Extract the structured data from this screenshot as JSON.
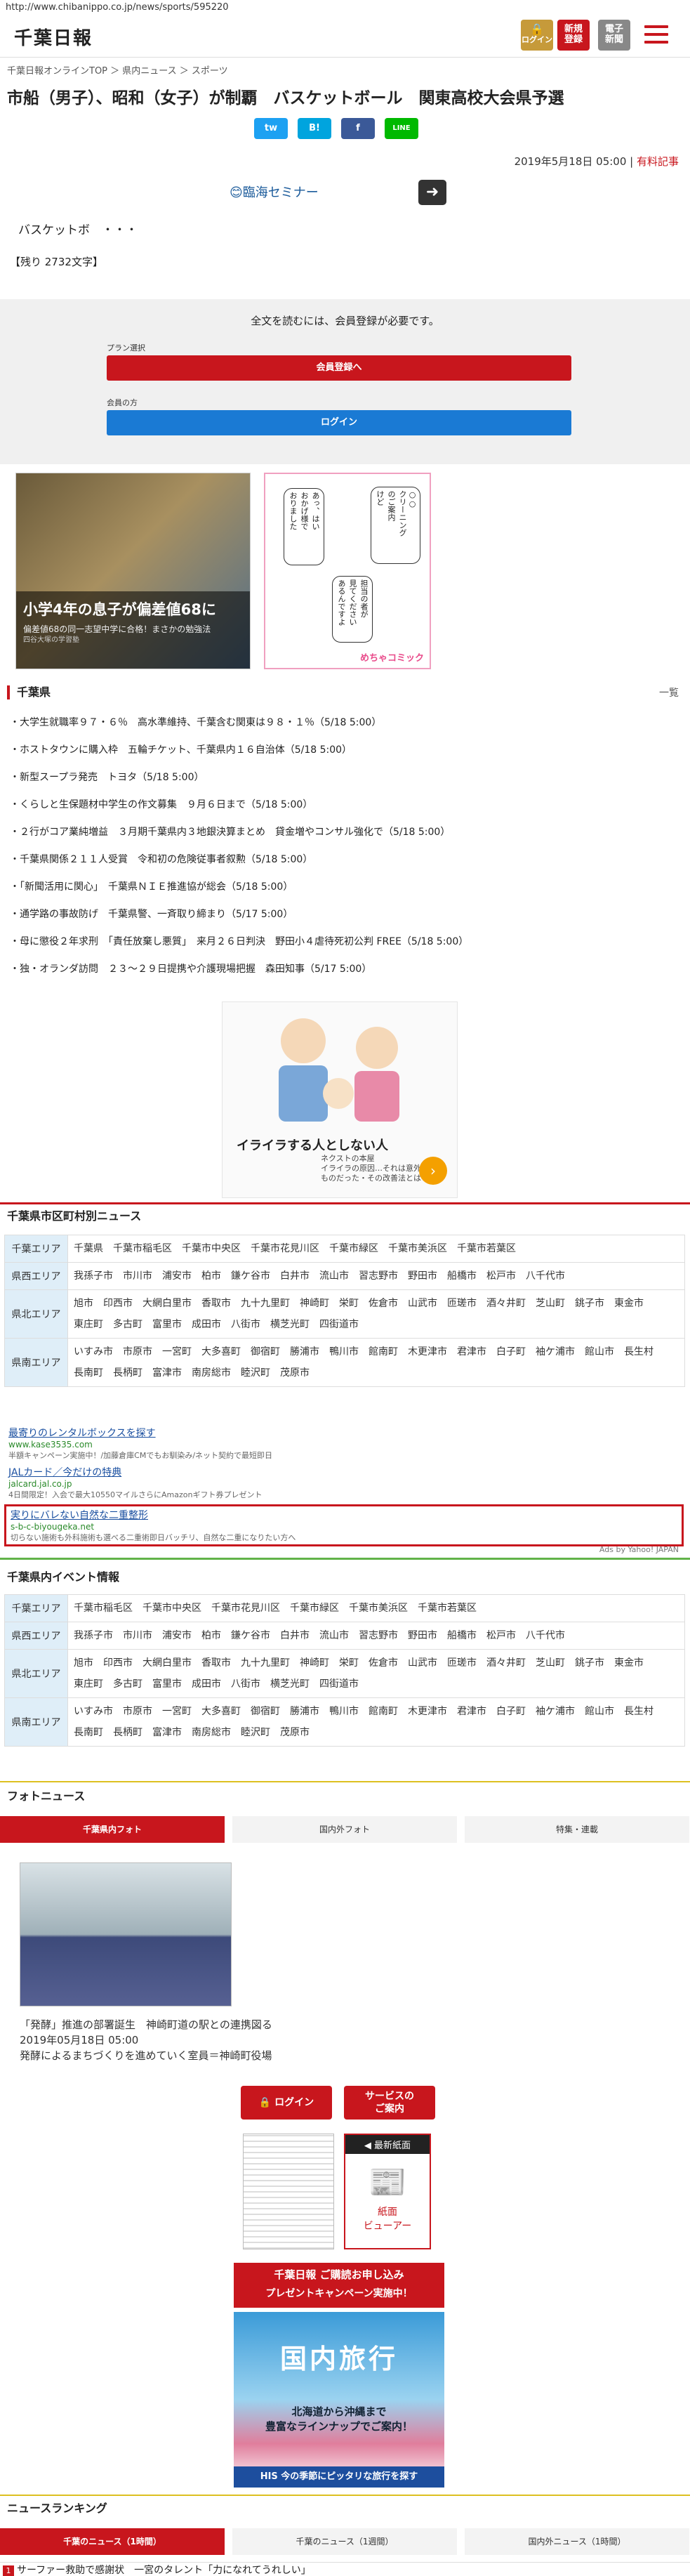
{
  "url": "http://www.chibanippo.co.jp/news/sports/595220",
  "header": {
    "logo": "千葉日報",
    "login": "ログイン",
    "register": "新規\n登録",
    "epaper": "電子\n新聞"
  },
  "breadcrumb": "千葉日報オンラインTOP ＞ 県内ニュース ＞ スポーツ",
  "article": {
    "title": "市船（男子）、昭和（女子）が制覇　バスケットボール　関東高校大会県予選",
    "share": [
      "tw",
      "B!",
      "f",
      "LINE"
    ],
    "date": "2019年5月18日 05:00",
    "paid": "有料記事",
    "ad_text": "臨海セミナー",
    "body": "バスケットボ　・・・",
    "remaining": "【残り 2732文字】"
  },
  "member": {
    "notice": "全文を読むには、会員登録が必要です。",
    "plan_label": "プラン選択",
    "register_button": "会員登録へ",
    "member_label": "会員の方",
    "login_button": "ログイン"
  },
  "promo": {
    "photo_title": "小学4年の息子が偏差値68に",
    "photo_desc": "偏差値68の同一志望中学に合格！まさかの勉強法",
    "photo_src": "四谷大塚の学習塾",
    "comic_bubbles": [
      "あっ、はい\nおかげ様で\nおりました",
      "○○\nクリーニング\nのご案内\nけど",
      "担当の者が\n見てください\nあるんですよ"
    ],
    "comic_footer": "めちゃコミック"
  },
  "chiba": {
    "heading": "千葉県",
    "more": "一覧",
    "items": [
      "・大学生就職率９７・６％　高水準維持、千葉含む関東は９８・１％（5/18 5:00）",
      "・ホストタウンに購入枠　五輪チケット、千葉県内１６自治体（5/18 5:00）",
      "・新型スープラ発売　トヨタ（5/18 5:00）",
      "・くらしと生保題材中学生の作文募集　９月６日まで（5/18 5:00）",
      "・２行がコア業純増益　３月期千葉県内３地銀決算まとめ　貸金増やコンサル強化で（5/18 5:00）",
      "・千葉県関係２１１人受賞　令和初の危険従事者叙勲（5/18 5:00）",
      "・「新聞活用に関心」　千葉県ＮＩＥ推進協が総会（5/18 5:00）",
      "・通学路の事故防げ　千葉県警、一斉取り締まり（5/17 5:00）",
      "・母に懲役２年求刑　「責任放棄し悪質」　来月２６日判決　野田小４虐待死初公判 FREE（5/18 5:00）",
      "・独・オランダ訪問　２３〜２９日提携や介護現場把握　森田知事（5/17 5:00）"
    ]
  },
  "ad2": {
    "title": "イライラする人としない人",
    "sub": "ネクストの本屋\nイライラの原因…それは意外な\nものだった・その改善法とは",
    "go": "›"
  },
  "municipal": {
    "heading": "千葉県市区町村別ニュース",
    "rows": [
      {
        "area": "千葉エリア",
        "cities": [
          "千葉県",
          "千葉市稲毛区",
          "千葉市中央区",
          "千葉市花見川区",
          "千葉市緑区",
          "千葉市美浜区",
          "千葉市若葉区"
        ]
      },
      {
        "area": "県西エリア",
        "cities": [
          "我孫子市",
          "市川市",
          "浦安市",
          "柏市",
          "鎌ケ谷市",
          "白井市",
          "流山市",
          "習志野市",
          "野田市",
          "船橋市",
          "松戸市",
          "八千代市"
        ]
      },
      {
        "area": "県北エリア",
        "cities": [
          "旭市",
          "印西市",
          "大網白里市",
          "香取市",
          "九十九里町",
          "神崎町",
          "栄町",
          "佐倉市",
          "山武市",
          "匝瑳市",
          "酒々井町",
          "芝山町",
          "銚子市",
          "東金市",
          "東庄町",
          "多古町",
          "富里市",
          "成田市",
          "八街市",
          "横芝光町",
          "四街道市"
        ]
      },
      {
        "area": "県南エリア",
        "cities": [
          "いすみ市",
          "市原市",
          "一宮町",
          "大多喜町",
          "御宿町",
          "勝浦市",
          "鴨川市",
          "館南町",
          "木更津市",
          "君津市",
          "白子町",
          "袖ケ浦市",
          "館山市",
          "長生村",
          "長南町",
          "長柄町",
          "富津市",
          "南房総市",
          "睦沢町",
          "茂原市"
        ]
      }
    ]
  },
  "yahoo_ads": [
    {
      "title": "最寄りのレンタルボックスを探す",
      "url": "www.kase3535.com",
      "desc": "半額キャンペーン実施中！/加藤倉庫CMでもお馴染み/ネット契約で最短即日"
    },
    {
      "title": "JALカード／今だけの特典",
      "url": "jalcard.jal.co.jp",
      "desc": "4日間限定！入会で最大10550マイルさらにAmazonギフト券プレゼント"
    },
    {
      "title": "実りにバレない自然な二重整形",
      "url": "s-b-c-biyougeka.net",
      "desc": "切らない施術も外科施術も選べる二重術即日バッチリ、自然な二重になりたい方へ"
    }
  ],
  "ads_by": "Ads by Yahoo! JAPAN",
  "events": {
    "heading": "千葉県内イベント情報",
    "rows": [
      {
        "area": "千葉エリア",
        "cities": [
          "千葉市稲毛区",
          "千葉市中央区",
          "千葉市花見川区",
          "千葉市緑区",
          "千葉市美浜区",
          "千葉市若葉区"
        ]
      },
      {
        "area": "県西エリア",
        "cities": [
          "我孫子市",
          "市川市",
          "浦安市",
          "柏市",
          "鎌ケ谷市",
          "白井市",
          "流山市",
          "習志野市",
          "野田市",
          "船橋市",
          "松戸市",
          "八千代市"
        ]
      },
      {
        "area": "県北エリア",
        "cities": [
          "旭市",
          "印西市",
          "大網白里市",
          "香取市",
          "九十九里町",
          "神崎町",
          "栄町",
          "佐倉市",
          "山武市",
          "匝瑳市",
          "酒々井町",
          "芝山町",
          "銚子市",
          "東金市",
          "東庄町",
          "多古町",
          "富里市",
          "成田市",
          "八街市",
          "横芝光町",
          "四街道市"
        ]
      },
      {
        "area": "県南エリア",
        "cities": [
          "いすみ市",
          "市原市",
          "一宮町",
          "大多喜町",
          "御宿町",
          "勝浦市",
          "鴨川市",
          "館南町",
          "木更津市",
          "君津市",
          "白子町",
          "袖ケ浦市",
          "館山市",
          "長生村",
          "長南町",
          "長柄町",
          "富津市",
          "南房総市",
          "睦沢町",
          "茂原市"
        ]
      }
    ]
  },
  "photo_news": {
    "heading": "フォトニュース",
    "tabs": [
      "千葉県内フォト",
      "国内外フォト",
      "特集・連載"
    ],
    "caption": "「発酵」推進の部署誕生　神崎町道の駅との連携図る",
    "date": "2019年05月18日 05:00",
    "desc": "発酵によるまちづくりを進めていく室員＝神崎町役場"
  },
  "side": {
    "login": "ログイン",
    "service": "サービスの\nご案内",
    "latest": "◀ 最新紙面",
    "viewer": "紙面\nビューアー"
  },
  "banner": {
    "top": "千葉日報 ご購読お申し込み",
    "top2": "プレゼントキャンペーン実施中！",
    "big": "国内旅行",
    "sub": "北海道から沖縄まで\n豊富なラインナップでご案内！",
    "his": "HIS 今の季節にピッタリな旅行を探す"
  },
  "ranking": {
    "heading": "ニュースランキング",
    "tabs": [
      "千葉のニュース（1時間）",
      "千葉のニュース（1週間）",
      "国内外ニュース（1時間）"
    ],
    "first": "サーファー救助で感謝状　一宮のタレント「力になれてうれしい」",
    "rank": "1"
  },
  "colors": {
    "accent": "#c8161d",
    "twitter": "#1da1f2",
    "hatena": "#00a4de",
    "facebook": "#3b5998",
    "line": "#00b900",
    "blue_button": "#1a7ad4"
  }
}
